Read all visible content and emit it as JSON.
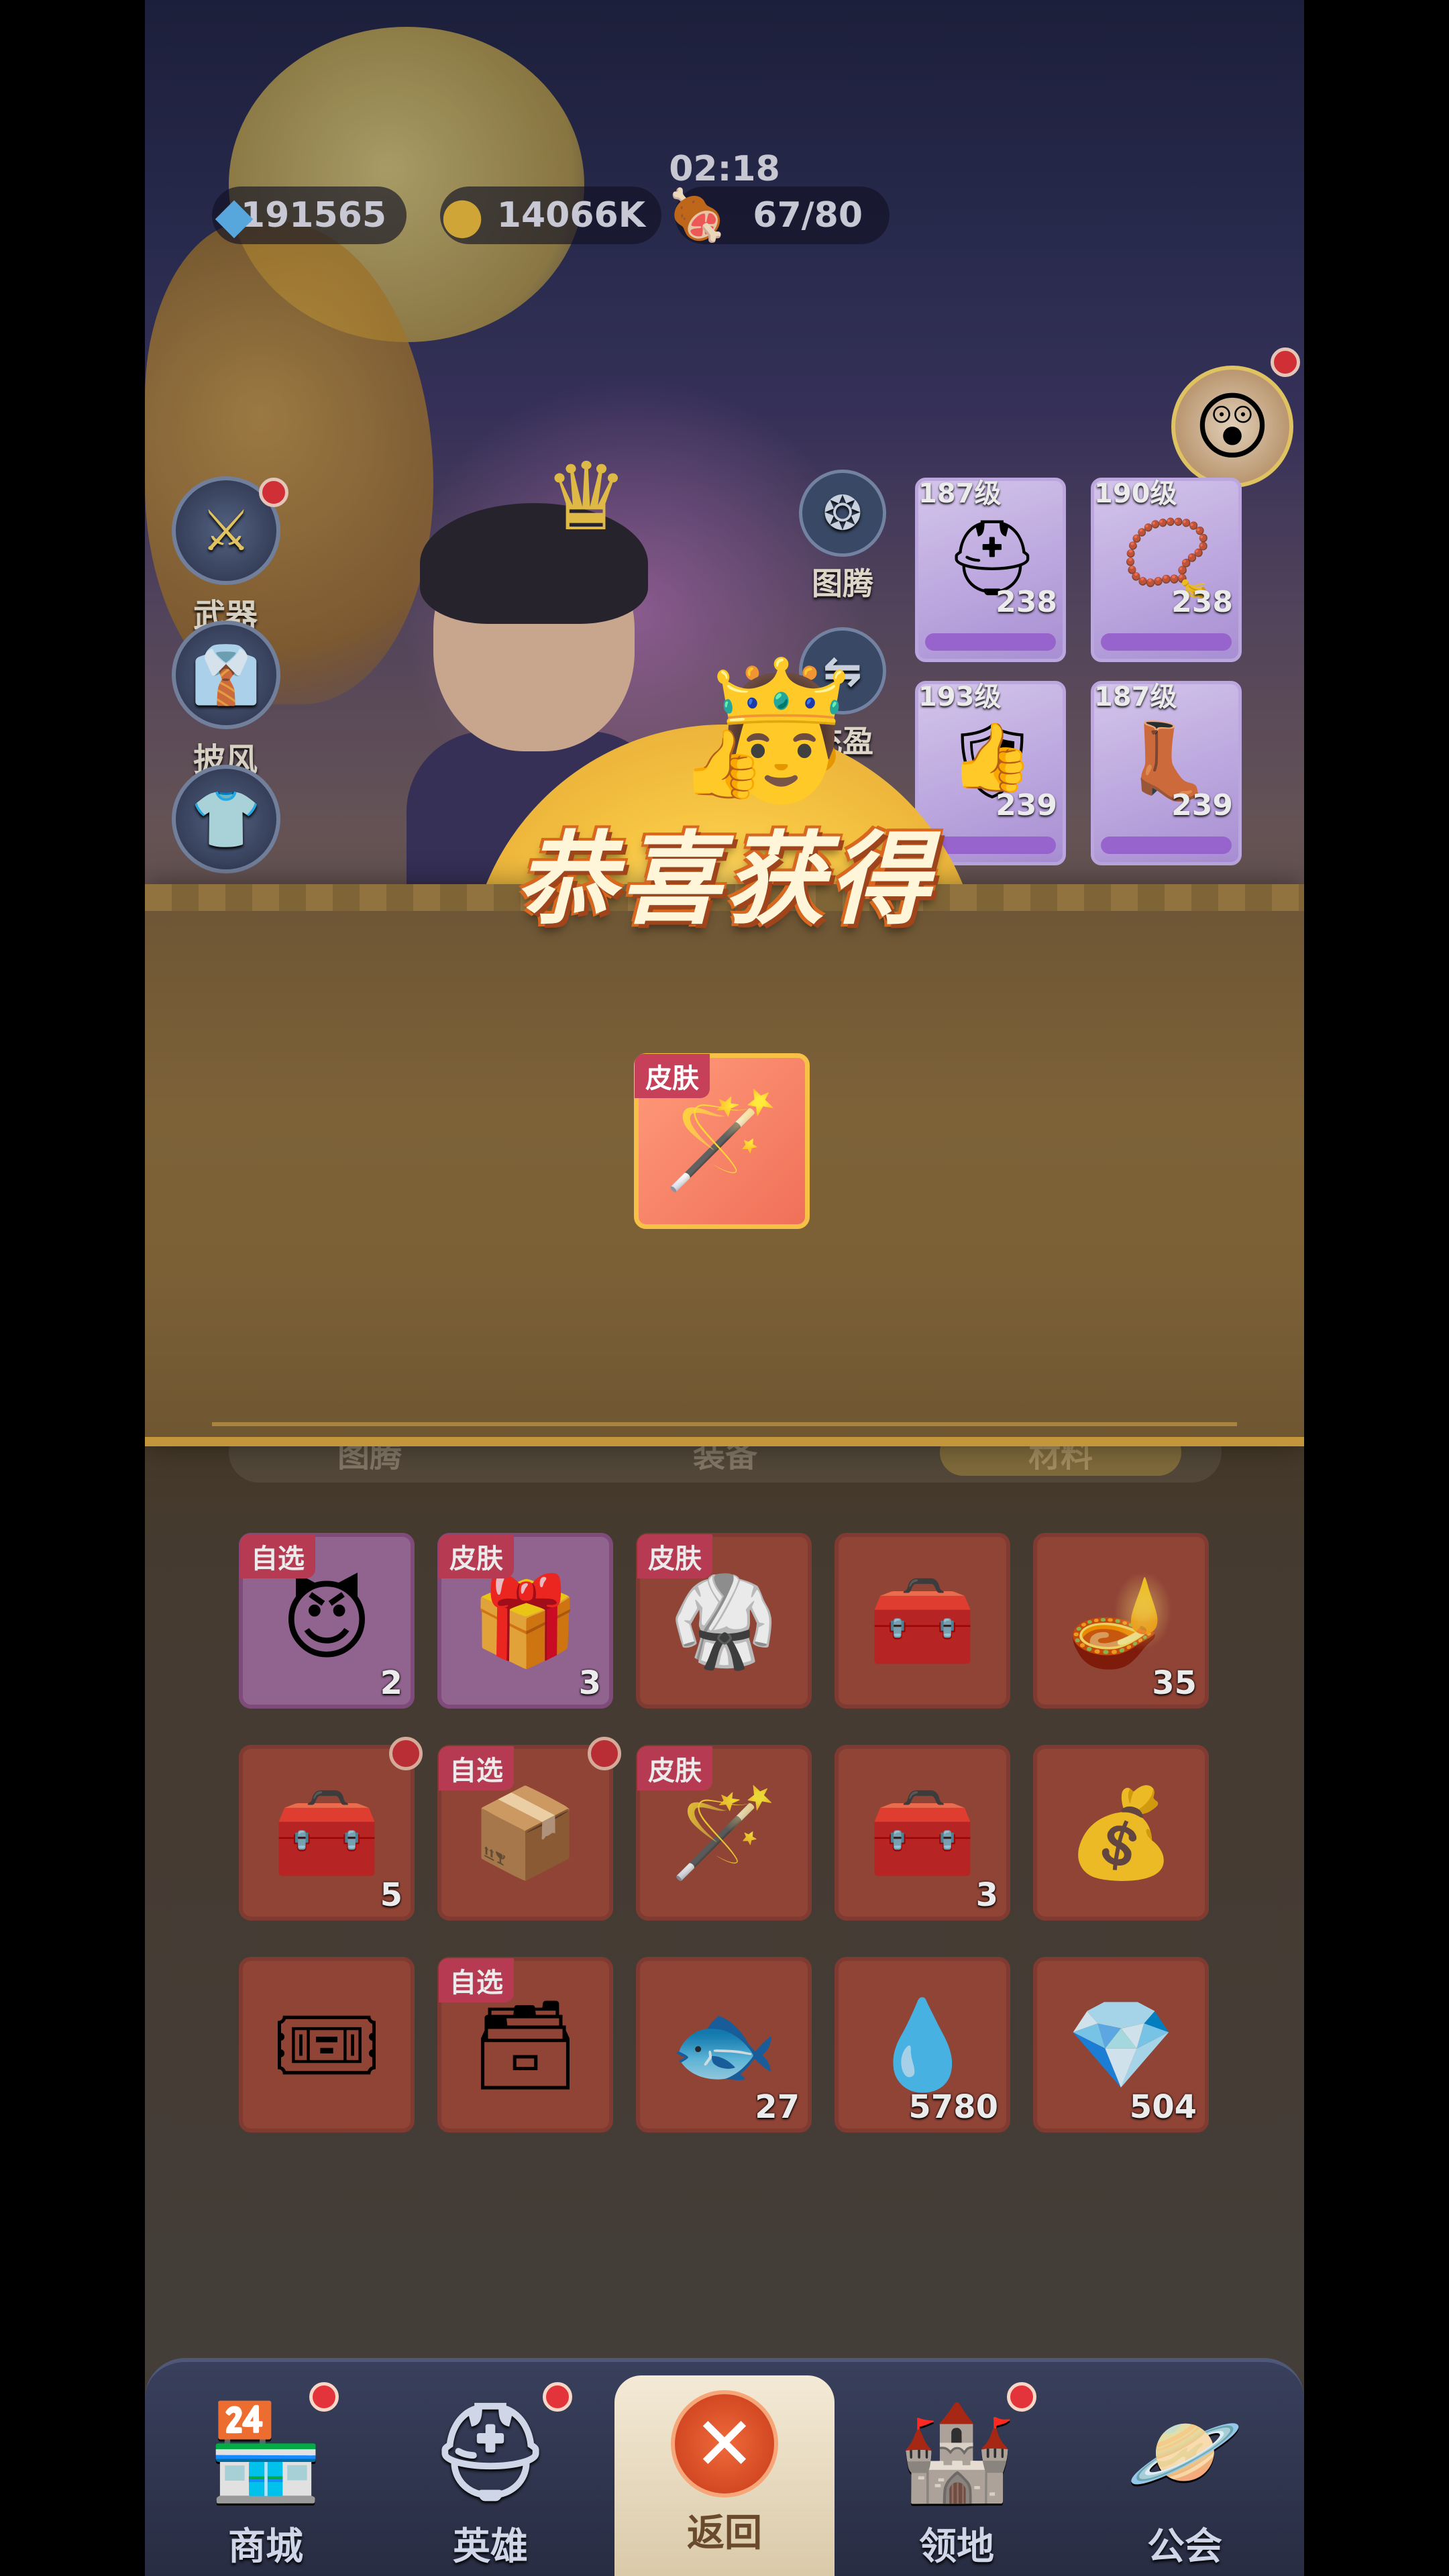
{
  "resources": {
    "gems": "191565",
    "gold": "14066K",
    "stamina": "67/80",
    "timer": "02:18"
  },
  "left_menu": [
    {
      "label": "武器"
    },
    {
      "label": "披风"
    },
    {
      "label": "皮肤"
    }
  ],
  "mid_menu": [
    {
      "label": "图腾"
    },
    {
      "label": "充盈"
    }
  ],
  "equipment": [
    {
      "level": "187级",
      "count": "238"
    },
    {
      "level": "190级",
      "count": "238"
    },
    {
      "level": "193级",
      "count": "239"
    },
    {
      "level": "187级",
      "count": "239"
    }
  ],
  "popup": {
    "title": "恭喜获得",
    "reward_badge": "皮肤"
  },
  "bag_tabs": [
    "图腾",
    "装备",
    "材料"
  ],
  "inventory": [
    {
      "badge": "自选",
      "count": "2",
      "icon": "red-orb-icon",
      "style": "purple"
    },
    {
      "badge": "皮肤",
      "count": "3",
      "icon": "purple-chest-icon",
      "style": "purple"
    },
    {
      "badge": "皮肤",
      "count": "",
      "icon": "armor-icon",
      "style": "red"
    },
    {
      "badge": "",
      "count": "",
      "icon": "mystery-chest-icon",
      "style": "red"
    },
    {
      "badge": "",
      "count": "35",
      "icon": "magic-lamp-icon",
      "style": "red"
    },
    {
      "badge": "",
      "count": "5",
      "icon": "mystery-chest-icon",
      "style": "red",
      "dot": true
    },
    {
      "badge": "自选",
      "count": "",
      "icon": "gift-box-icon",
      "style": "red",
      "dot": true
    },
    {
      "badge": "皮肤",
      "count": "",
      "icon": "staff-icon",
      "style": "red"
    },
    {
      "badge": "",
      "count": "3",
      "icon": "mystery-chest-icon",
      "style": "red"
    },
    {
      "badge": "",
      "count": "",
      "icon": "golden-chest-icon",
      "style": "red"
    },
    {
      "badge": "",
      "count": "",
      "icon": "ticket-icon",
      "style": "red"
    },
    {
      "badge": "自选",
      "count": "",
      "icon": "dark-chest-icon",
      "style": "red"
    },
    {
      "badge": "",
      "count": "27",
      "icon": "fish-icon",
      "style": "red"
    },
    {
      "badge": "",
      "count": "5780",
      "icon": "essence-drop-icon",
      "style": "red"
    },
    {
      "badge": "",
      "count": "504",
      "icon": "crystal-icon",
      "style": "red"
    }
  ],
  "nav": [
    {
      "label": "商城"
    },
    {
      "label": "英雄"
    },
    {
      "label": "返回"
    },
    {
      "label": "领地"
    },
    {
      "label": "公会"
    }
  ],
  "colors": {
    "accent_red": "#e2343a",
    "gold": "#f7c047",
    "badge_pink": "#c6405a"
  }
}
